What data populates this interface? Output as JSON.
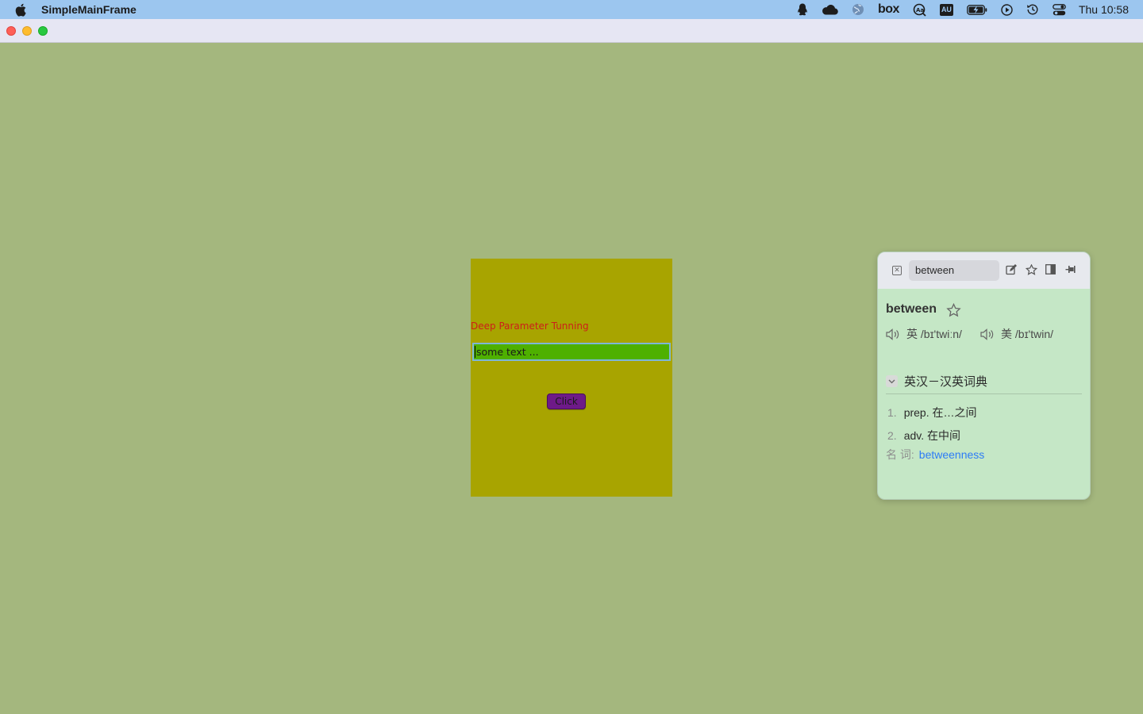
{
  "menubar": {
    "app_name": "SimpleMainFrame",
    "icons": [
      "apple-icon",
      "qq-penguin-icon",
      "cloud-icon",
      "globe-icon",
      "box-icon",
      "dictionary-icon",
      "au-icon",
      "battery-icon",
      "play-icon",
      "time-machine-icon",
      "control-center-icon"
    ],
    "box_label": "box",
    "au_label": "AU",
    "clock": "Thu 10:58"
  },
  "window": {
    "title": ""
  },
  "panel": {
    "label": "Deep Parameter Tunning",
    "input_value": "some text ...",
    "button_label": "Click"
  },
  "dictionary": {
    "search_value": "between",
    "word": "between",
    "pronunciations": [
      {
        "region": "英",
        "ipa": "/bɪ'twiːn/"
      },
      {
        "region": "美",
        "ipa": "/bɪ'twin/"
      }
    ],
    "source": "英汉－汉英词典",
    "definitions": [
      {
        "num": "1.",
        "text": "prep. 在…之间"
      },
      {
        "num": "2.",
        "text": "adv. 在中间"
      }
    ],
    "derivative_label": "名 词:",
    "derivative_word": "betweenness"
  }
}
